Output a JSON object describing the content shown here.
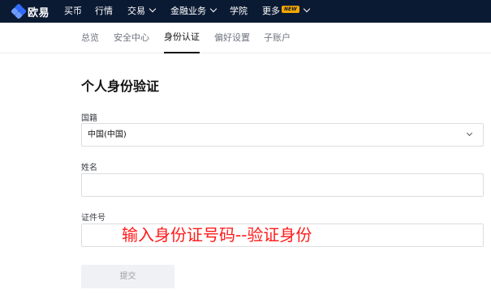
{
  "brand": {
    "name": "欧易",
    "accent": "#2f6bff"
  },
  "topnav": {
    "items": [
      {
        "label": "买币",
        "has_dropdown": false
      },
      {
        "label": "行情",
        "has_dropdown": false
      },
      {
        "label": "交易",
        "has_dropdown": true
      },
      {
        "label": "金融业务",
        "has_dropdown": true
      },
      {
        "label": "学院",
        "has_dropdown": false
      },
      {
        "label": "更多",
        "has_dropdown": true,
        "badge": "NEW"
      }
    ]
  },
  "subnav": {
    "tabs": [
      {
        "label": "总览",
        "active": false
      },
      {
        "label": "安全中心",
        "active": false
      },
      {
        "label": "身份认证",
        "active": true
      },
      {
        "label": "偏好设置",
        "active": false
      },
      {
        "label": "子账户",
        "active": false
      }
    ]
  },
  "page": {
    "title": "个人身份验证"
  },
  "form": {
    "nationality": {
      "label": "国籍",
      "value": "中国(中国)"
    },
    "name": {
      "label": "姓名",
      "value": ""
    },
    "id_number": {
      "label": "证件号",
      "value": ""
    },
    "submit_label": "提交"
  },
  "overlay_text": "输入身份证号码--验证身份"
}
